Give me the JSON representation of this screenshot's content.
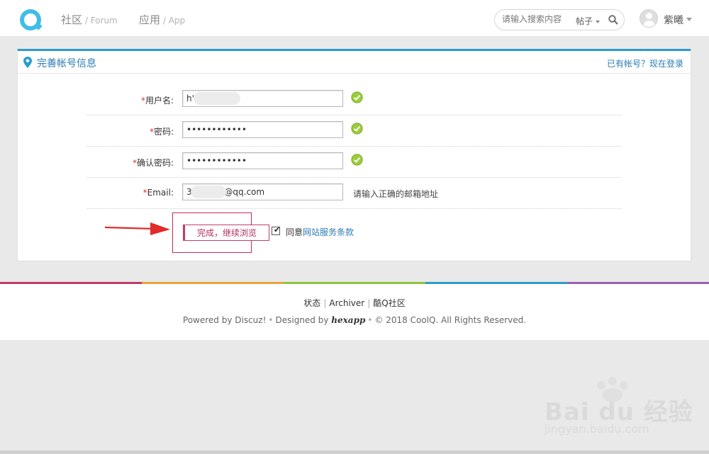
{
  "header": {
    "nav": [
      {
        "label": "社区",
        "sub": " / Forum"
      },
      {
        "label": "应用",
        "sub": " / App"
      }
    ],
    "search": {
      "placeholder": "请输入搜索内容",
      "type_label": "帖子"
    },
    "user": {
      "name": "紫曦"
    }
  },
  "panel": {
    "title": "完善帐号信息",
    "login_link": "已有帐号？现在登录",
    "fields": [
      {
        "required_mark": "*",
        "label": "用户名:",
        "value": "h'",
        "status": "ok"
      },
      {
        "required_mark": "*",
        "label": "密码:",
        "value": "••••••••••••",
        "status": "ok"
      },
      {
        "required_mark": "*",
        "label": "确认密码:",
        "value": "••••••••••••",
        "status": "ok"
      },
      {
        "required_mark": "*",
        "label": "Email:",
        "value": "3.           @qq.com",
        "hint": "请输入正确的邮箱地址"
      }
    ],
    "submit_label": "完成，继续浏览",
    "agree": {
      "checked": true,
      "prefix": "同意",
      "link": "网站服务条款"
    }
  },
  "footer": {
    "links": [
      "状态",
      "Archiver",
      "酷Q社区"
    ],
    "powered_by": "Powered by Discuz!",
    "designed_by": "Designed by",
    "designer": "hexapp",
    "copyright": "© 2018 CoolQ. All Rights Reserved.",
    "rainbow_colors": [
      "#c23b6a",
      "#e8a43b",
      "#8fc43f",
      "#2b9ccf",
      "#9a5fb4"
    ]
  },
  "watermark": {
    "text": "Bai du 经验",
    "sub": "jingyan.baidu.com"
  },
  "colors": {
    "accent": "#2b9ccf",
    "link": "#2b7cb4",
    "ok": "#8fc43f",
    "highlight": "#c92a55"
  }
}
